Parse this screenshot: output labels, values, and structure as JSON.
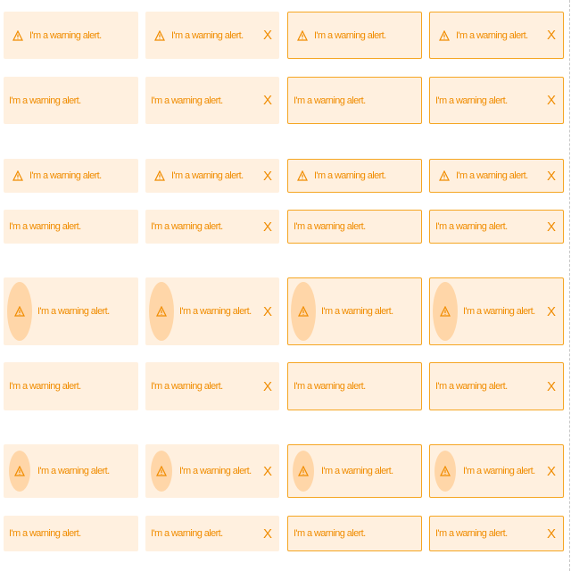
{
  "alert": {
    "message": "I'm a warning alert.",
    "close_glyph": "X"
  },
  "colors": {
    "background": "#fff0df",
    "text": "#f08c00",
    "border": "#f5a623",
    "icon_circle": "#ffd6a8"
  },
  "icons": {
    "warning": "warning-triangle-icon",
    "close": "close-icon"
  }
}
